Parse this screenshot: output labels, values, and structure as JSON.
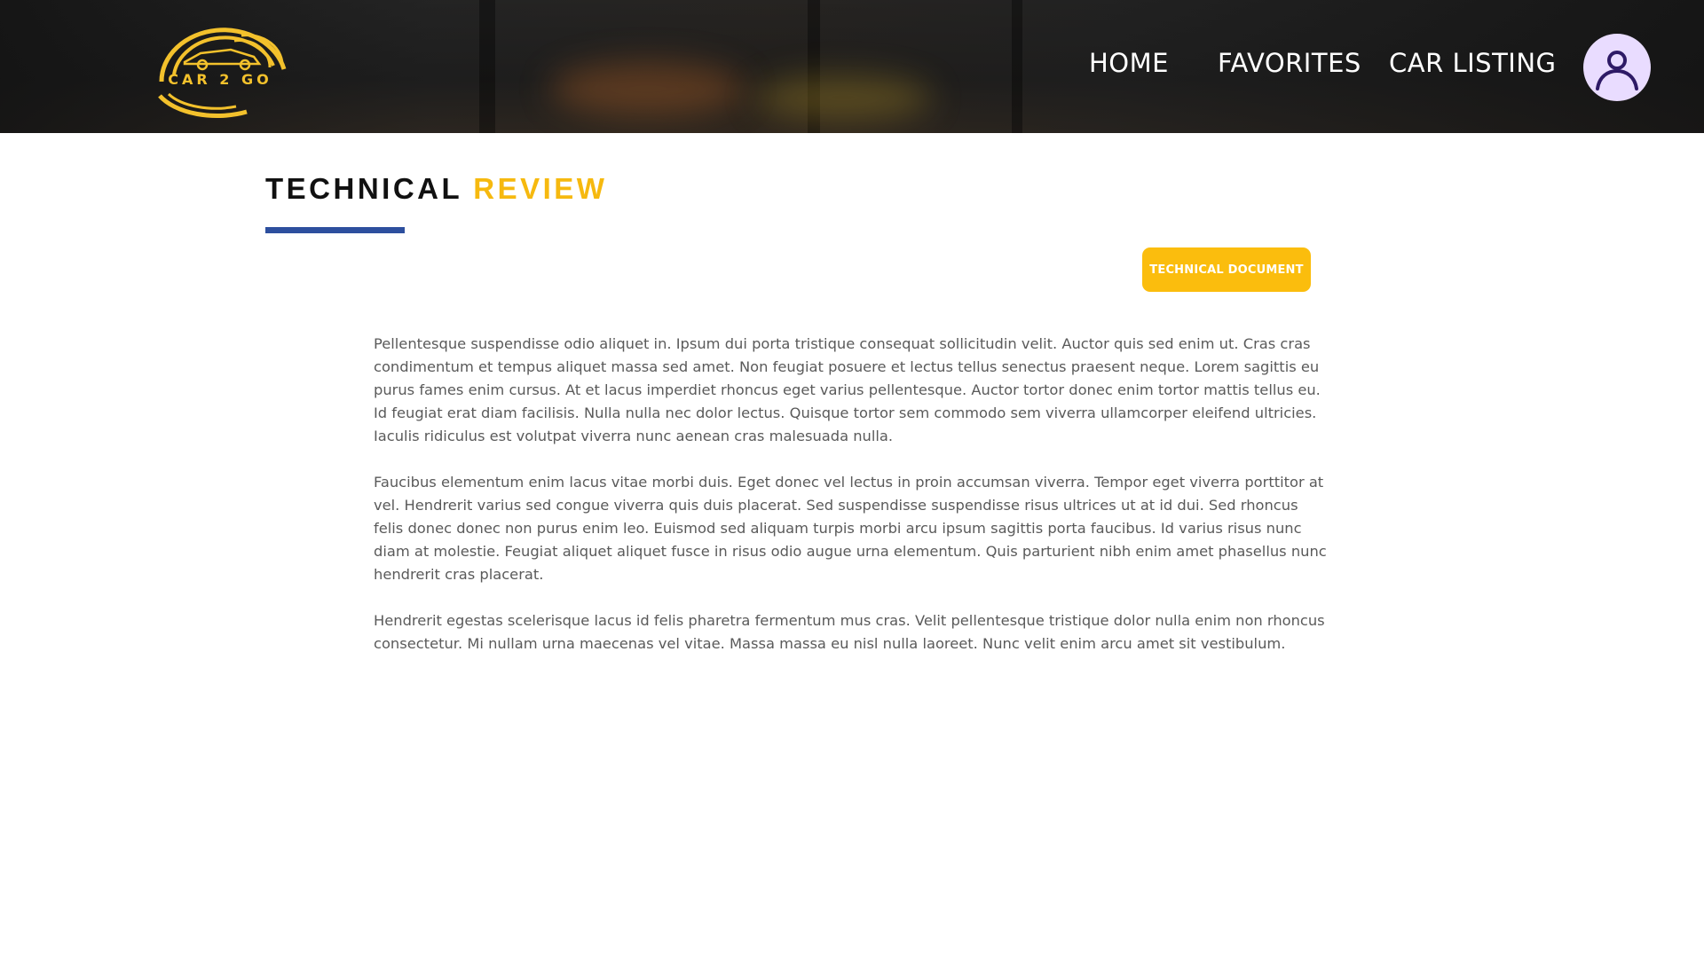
{
  "header": {
    "logo_text": "CAR 2 GO",
    "nav": {
      "home": "HOME",
      "favorites": "FAVORITES",
      "car_listing": "CAR LISTING"
    },
    "avatar_icon": "user-icon"
  },
  "page": {
    "title_part1": "TECHNICAL",
    "title_part2": "REVIEW",
    "document_button": "TECHNICAL DOCUMENT",
    "paragraphs": [
      "Pellentesque suspendisse odio aliquet in. Ipsum dui porta tristique consequat sollicitudin velit. Auctor quis sed enim ut. Cras cras condimentum et tempus aliquet massa sed amet. Non feugiat posuere et lectus tellus senectus praesent neque. Lorem sagittis eu purus fames enim cursus. At et lacus imperdiet rhoncus eget varius pellentesque. Auctor tortor donec enim tortor mattis tellus eu. Id feugiat erat diam facilisis. Nulla nulla nec dolor lectus. Quisque tortor sem commodo sem viverra ullamcorper eleifend ultricies. Iaculis ridiculus est volutpat viverra nunc aenean cras malesuada nulla.",
      "Faucibus elementum enim lacus vitae morbi duis. Eget donec vel lectus in proin accumsan viverra. Tempor eget viverra porttitor at vel. Hendrerit varius sed congue viverra quis duis placerat. Sed suspendisse suspendisse risus ultrices ut at id dui. Sed rhoncus felis donec donec non purus enim leo. Euismod sed aliquam turpis morbi arcu ipsum sagittis porta faucibus. Id varius risus nunc diam at molestie. Feugiat aliquet aliquet fusce in risus odio augue urna elementum. Quis parturient nibh enim amet phasellus nunc hendrerit cras placerat.",
      "Hendrerit egestas scelerisque lacus id felis pharetra fermentum mus cras. Velit pellentesque tristique dolor nulla enim non rhoncus consectetur. Mi nullam urna maecenas vel vitae. Massa massa eu nisl nulla laoreet. Nunc velit enim arcu amet sit vestibulum."
    ]
  },
  "colors": {
    "accent_yellow": "#fbbd0d",
    "title_yellow": "#f6b90f",
    "underline_blue": "#2d4f9e",
    "header_dark": "#1f1f1f",
    "avatar_bg": "#e9dcff",
    "avatar_icon": "#2e1a66",
    "body_text": "#5a5a5a"
  }
}
